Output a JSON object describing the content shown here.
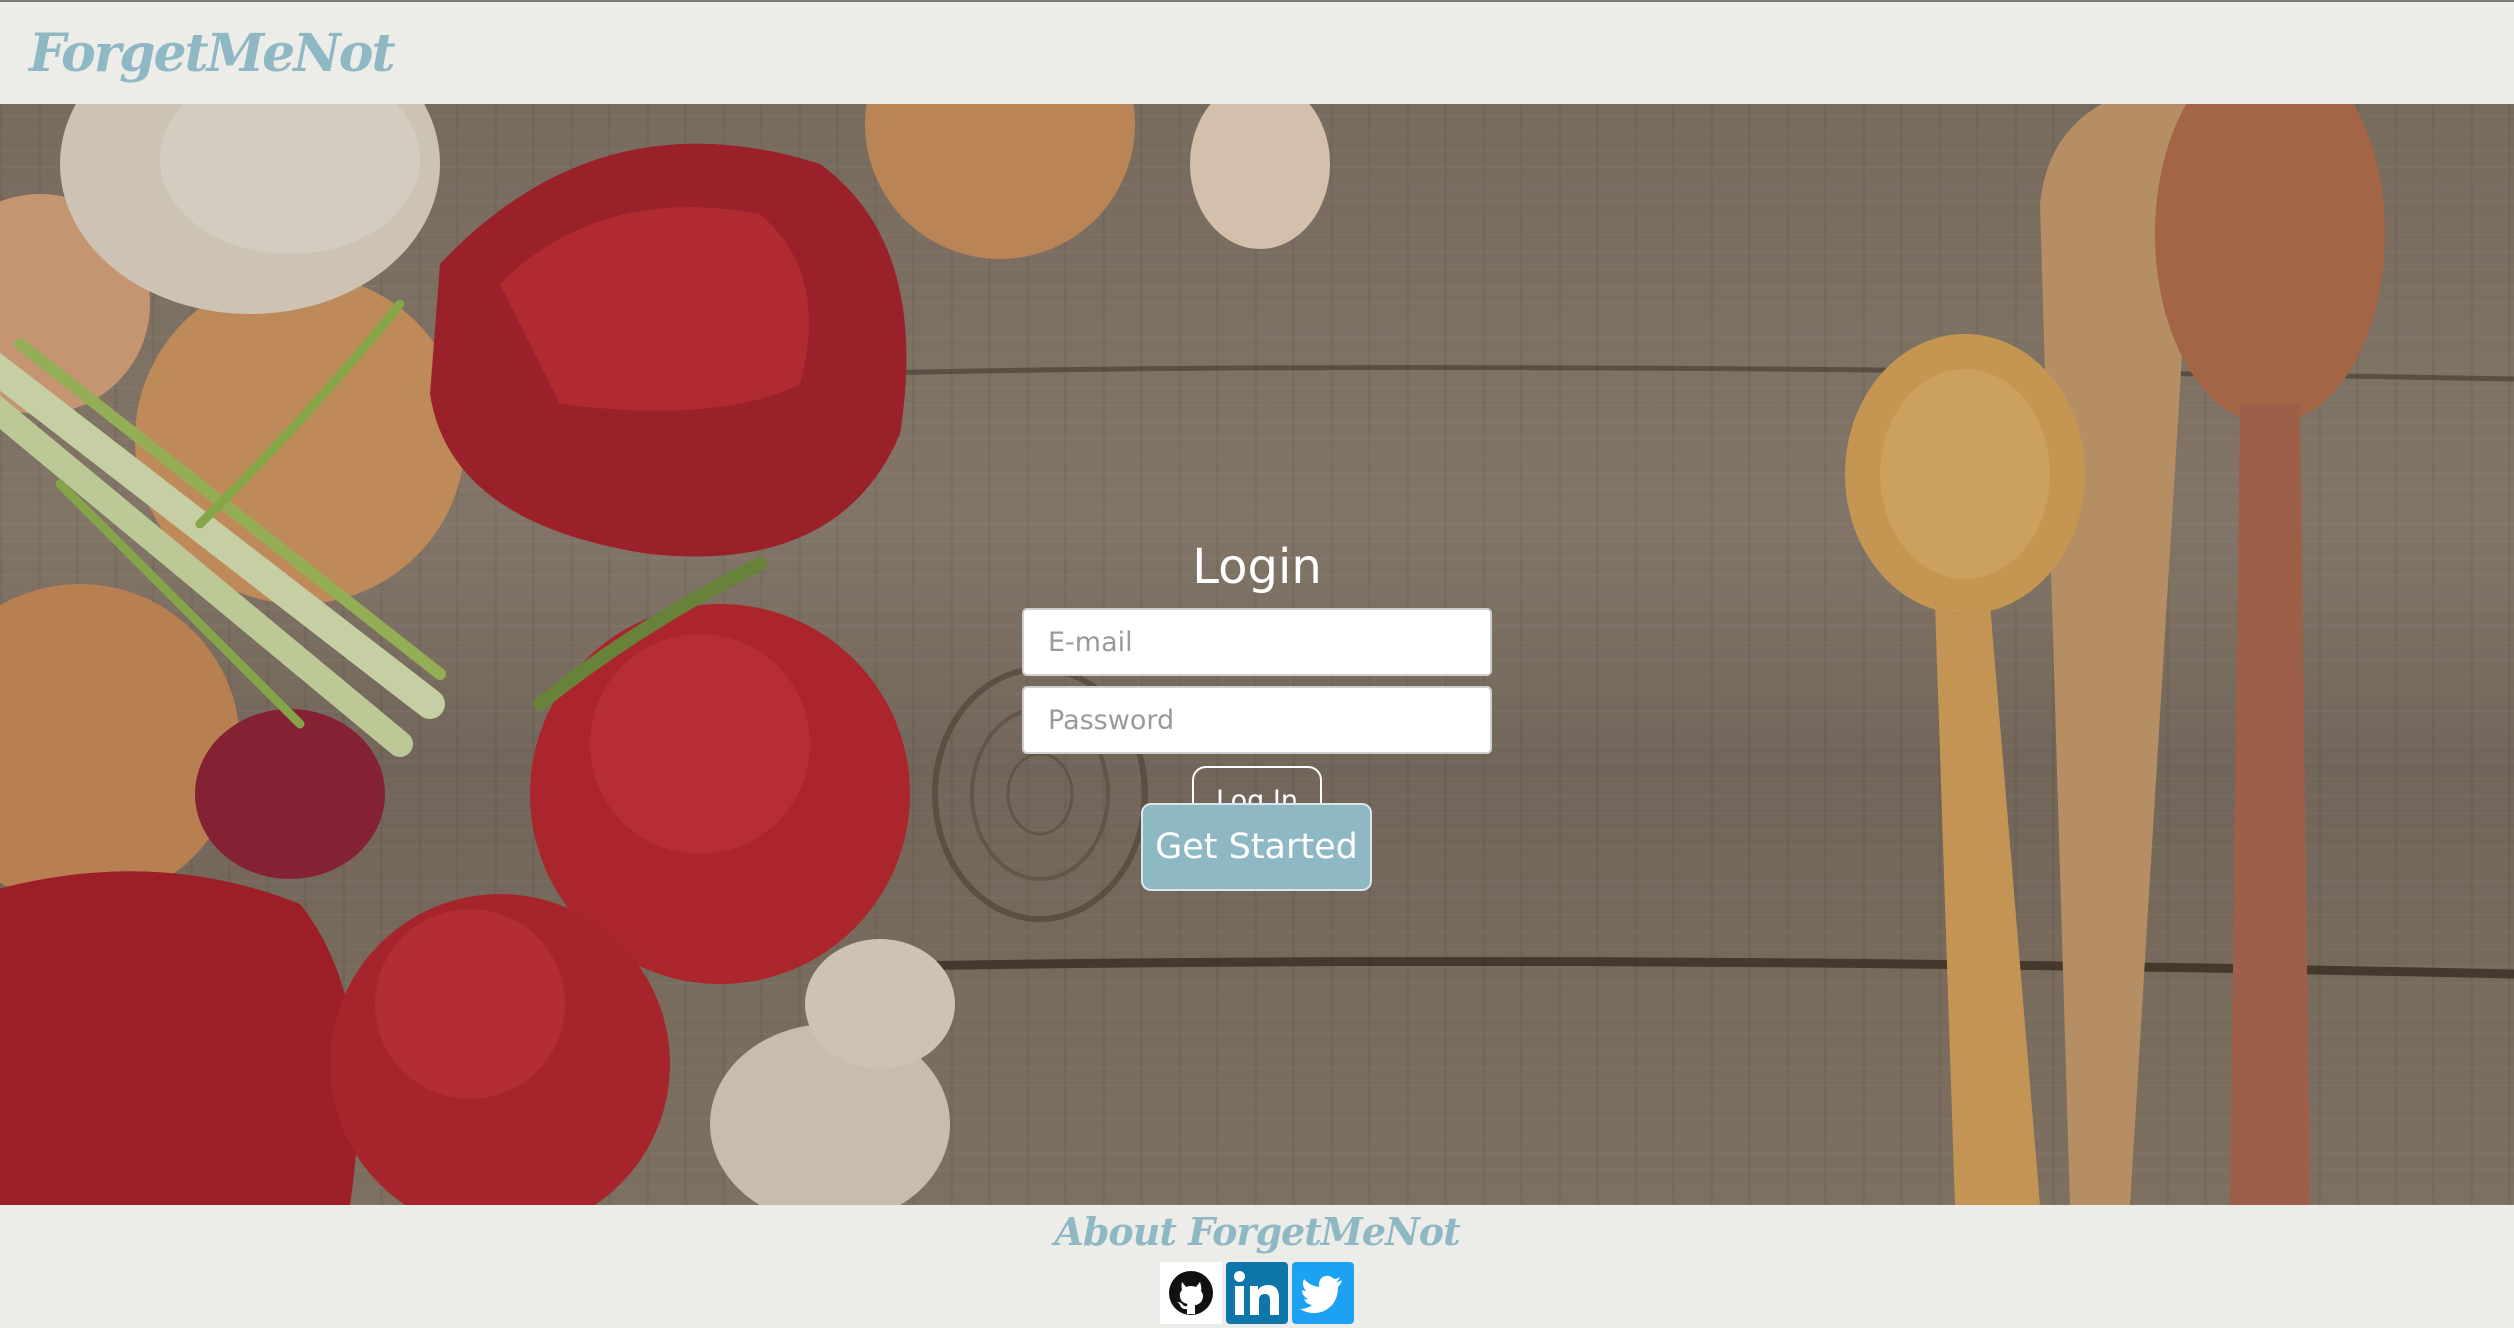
{
  "header": {
    "brand": "ForgetMeNot"
  },
  "login": {
    "title": "Login",
    "email_placeholder": "E-mail",
    "password_placeholder": "Password",
    "login_button": "Log In"
  },
  "cta": {
    "get_started": "Get Started"
  },
  "footer": {
    "about_link": "About ForgetMeNot",
    "social_icons": [
      "github-icon",
      "linkedin-icon",
      "twitter-icon"
    ]
  },
  "colors": {
    "brand": "#8fb8c5",
    "page_bg": "#ecece8",
    "linkedin": "#0e76a8",
    "twitter": "#1da1f2"
  }
}
